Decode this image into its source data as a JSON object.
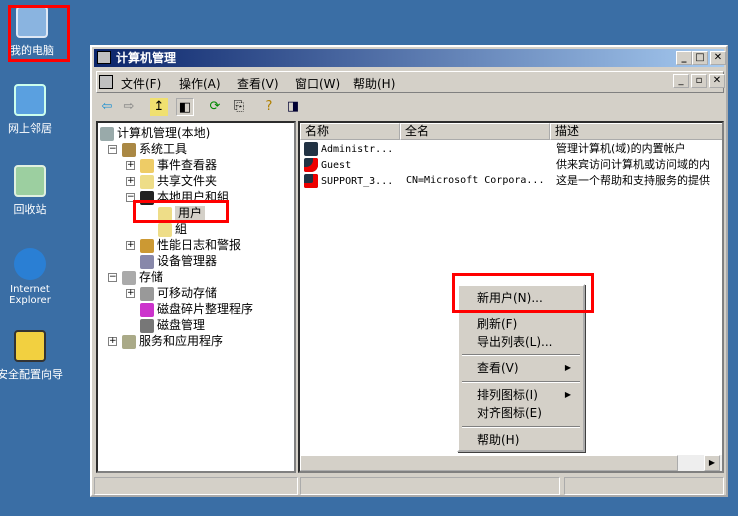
{
  "desktop": {
    "icons": [
      {
        "label": "我的电脑"
      },
      {
        "label": "网上邻居"
      },
      {
        "label": "回收站"
      },
      {
        "label": "Internet Explorer"
      },
      {
        "label": "安全配置向导"
      }
    ]
  },
  "window": {
    "title": "计算机管理",
    "menu": [
      "文件(F)",
      "操作(A)",
      "查看(V)",
      "窗口(W)",
      "帮助(H)"
    ]
  },
  "tree": {
    "root": "计算机管理(本地)",
    "items": [
      "系统工具",
      "事件查看器",
      "共享文件夹",
      "本地用户和組",
      "用户",
      "組",
      "性能日志和警报",
      "设备管理器",
      "存储",
      "可移动存储",
      "磁盘碎片整理程序",
      "磁盘管理",
      "服务和应用程序"
    ]
  },
  "list": {
    "columns": [
      "名称",
      "全名",
      "描述"
    ],
    "rows": [
      {
        "name": "Administr...",
        "fullname": "",
        "desc": "管理计算机(域)的内置帐户"
      },
      {
        "name": "Guest",
        "fullname": "",
        "desc": "供来宾访问计算机或访问域的内"
      },
      {
        "name": "SUPPORT_3...",
        "fullname": "CN=Microsoft Corpora...",
        "desc": "这是一个帮助和支持服务的提供"
      }
    ]
  },
  "context_menu": {
    "items": [
      "新用户(N)...",
      "刷新(F)",
      "导出列表(L)...",
      "查看(V)",
      "排列图标(I)",
      "对齐图标(E)",
      "帮助(H)"
    ]
  }
}
